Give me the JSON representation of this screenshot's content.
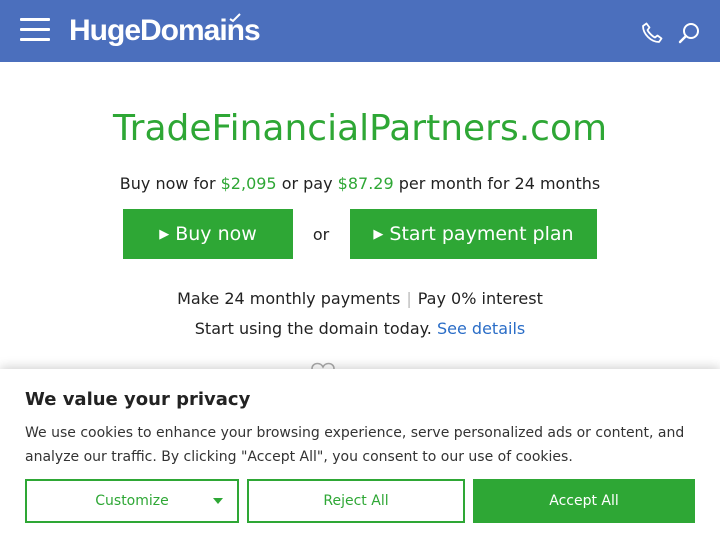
{
  "header": {
    "logo_text": "HugeDomains",
    "icons": [
      "menu-icon",
      "phone-icon",
      "search-icon"
    ]
  },
  "main": {
    "domain": "TradeFinancialPartners.com",
    "price_prefix": "Buy now for ",
    "price": "$2,095",
    "price_mid": " or pay ",
    "monthly": "$87.29",
    "price_suffix": " per month for 24 months",
    "buy_now_label": "Buy now",
    "or_label": "or",
    "payment_plan_label": "Start payment plan",
    "info_payments": "Make 24 monthly payments",
    "info_interest": "Pay 0% interest",
    "info_start": "Start using the domain today. ",
    "see_details_label": "See details"
  },
  "cookie_banner": {
    "title": "We value your privacy",
    "text": "We use cookies to enhance your browsing experience, serve personalized ads or content, and analyze our traffic. By clicking \"Accept All\", you consent to our use of cookies.",
    "customize_label": "Customize",
    "reject_label": "Reject All",
    "accept_label": "Accept All"
  },
  "colors": {
    "header_bg": "#4b6fbd",
    "brand_green": "#2ea735",
    "link_blue": "#2a6dc7"
  }
}
